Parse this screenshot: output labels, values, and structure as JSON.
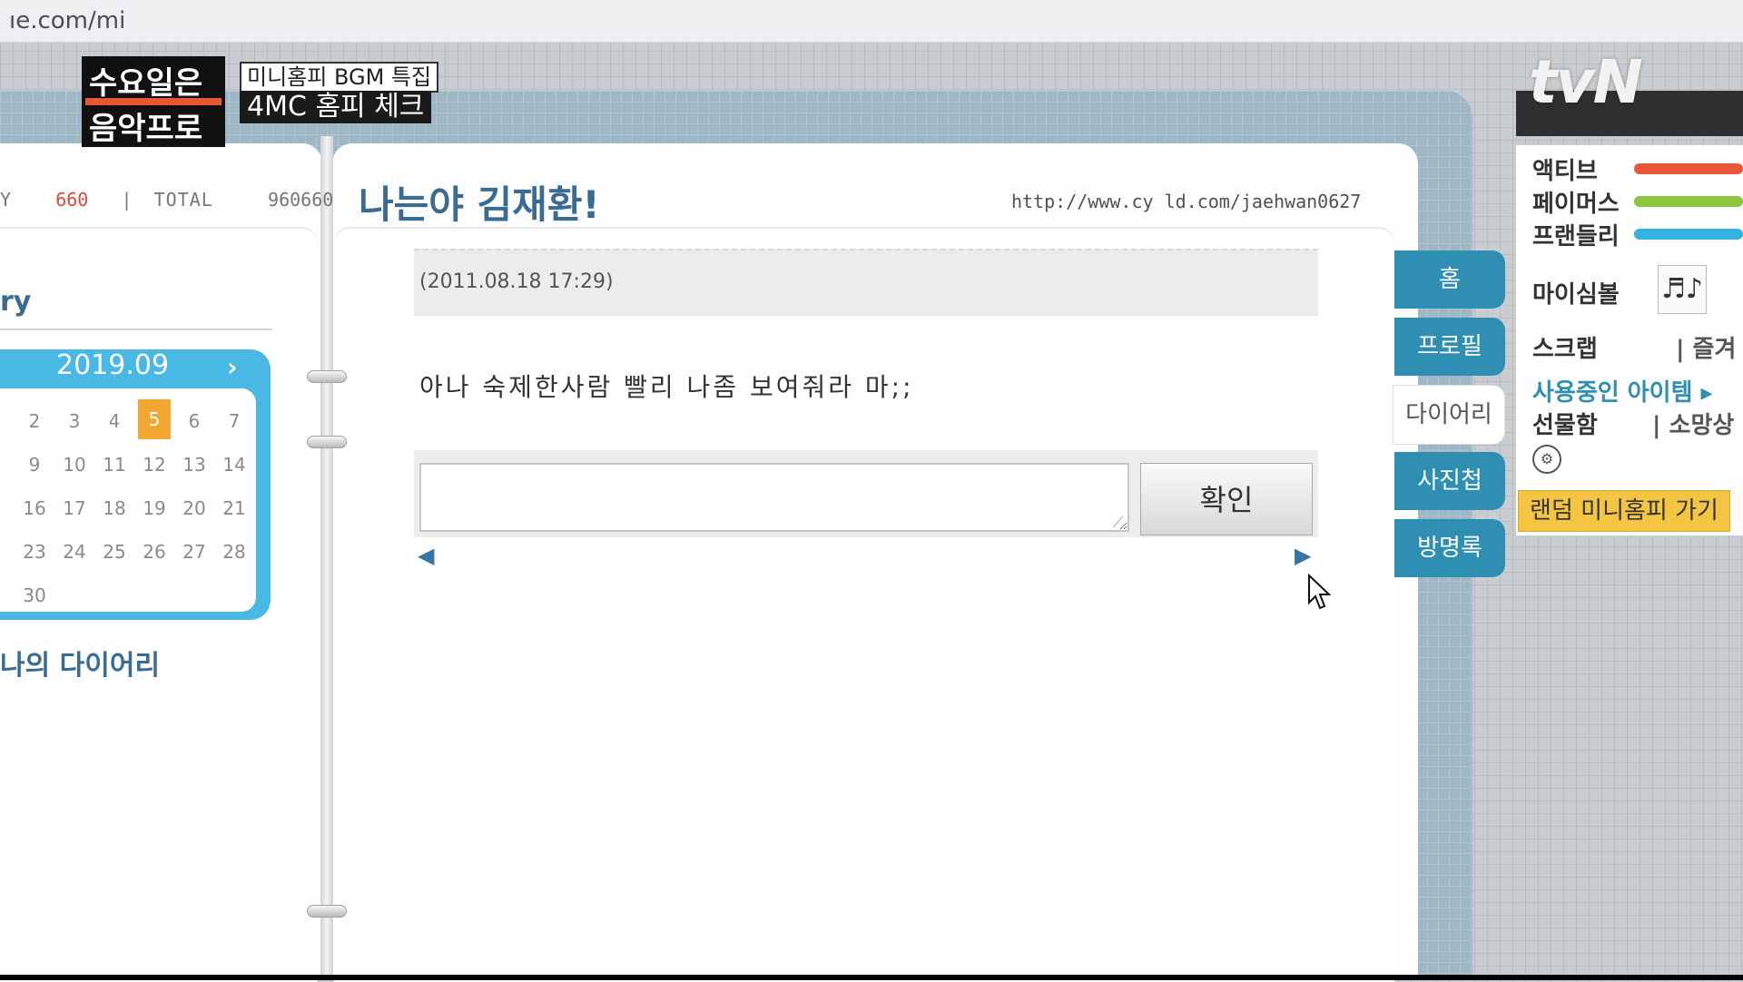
{
  "browser": {
    "url": "ıe.com/mi"
  },
  "overlay": {
    "show_logo_line1": "수요일은",
    "show_logo_line2": "음악프로",
    "caption_small": "미니홈피 BGM 특집",
    "caption_main": "4MC 홈피 체크",
    "channel": "tvN"
  },
  "header": {
    "today_label": "Y",
    "today_value": "660",
    "total_label": "TOTAL",
    "total_value": "960660",
    "title": "나는야 김재환!",
    "url": "http://www.cy    ld.com/jaehwan0627"
  },
  "left_panel": {
    "menu_title": "ry",
    "calendar": {
      "month": "2019.09",
      "next": "›",
      "rows": [
        [
          "2",
          "3",
          "4",
          "5",
          "6",
          "7"
        ],
        [
          "9",
          "10",
          "11",
          "12",
          "13",
          "14"
        ],
        [
          "16",
          "17",
          "18",
          "19",
          "20",
          "21"
        ],
        [
          "23",
          "24",
          "25",
          "26",
          "27",
          "28"
        ],
        [
          "30"
        ]
      ],
      "highlight": "5"
    },
    "my_diary": "나의 다이어리"
  },
  "main": {
    "date": "(2011.08.18 17:29)",
    "body": "아나 숙제한사람 빨리 나좀 보여줘라 마;;",
    "reply_placeholder": "",
    "confirm_label": "확인",
    "prev": "◀",
    "next": "▶"
  },
  "tabs": [
    "홈",
    "프로필",
    "다이어리",
    "사진첩",
    "방명록"
  ],
  "active_tab": "다이어리",
  "right_sidebar": {
    "status": [
      {
        "label": "액티브",
        "color": "#e9573a"
      },
      {
        "label": "페이머스",
        "color": "#8cc63f"
      },
      {
        "label": "프랜들리",
        "color": "#35b3e0"
      }
    ],
    "my_symbol": "마이심볼",
    "music_icon": "♬♪",
    "scrap": "스크랩",
    "favorites": "| 즐겨",
    "items_in_use": "사용중인 아이템 ▸",
    "gift_box": "선물함",
    "wish": "| 소망상",
    "random_button": "랜덤 미니홈피 가기"
  }
}
